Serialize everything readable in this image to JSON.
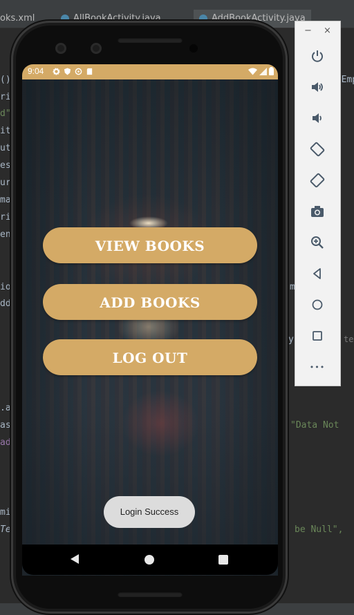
{
  "ide": {
    "tabs": [
      {
        "label": "oks.xml"
      },
      {
        "label": "AllBookActivity.java"
      },
      {
        "label": "AddBookActivity.java"
      }
    ],
    "code_left": [
      "()",
      "ri",
      "d\"",
      "it",
      "ut",
      "es",
      "ur",
      "ma",
      "ri",
      "en",
      "io",
      "dd",
      ".a",
      "as",
      "ad",
      "mi",
      "Te"
    ],
    "code_right": [
      {
        "text": "! Emp"
      },
      {
        "text": "\"Data Not"
      },
      {
        "text": "be Null\","
      },
      {
        "text": "tex"
      },
      {
        "text": "y"
      },
      {
        "text": "m"
      }
    ]
  },
  "status_bar": {
    "time": "9:04",
    "color": "#d4aa66"
  },
  "app": {
    "buttons": [
      {
        "label": "VIEW BOOKS"
      },
      {
        "label": "ADD BOOKS"
      },
      {
        "label": "LOG OUT"
      }
    ],
    "toast": "Login Success",
    "accent": "#d4aa66"
  },
  "nav": {
    "back_icon": "back-triangle-icon",
    "home_icon": "home-circle-icon",
    "recent_icon": "recents-square-icon"
  },
  "emulator_toolbar": {
    "minimize": "−",
    "close": "×",
    "tools": [
      "power-icon",
      "volume-up-icon",
      "volume-down-icon",
      "rotate-left-icon",
      "rotate-right-icon",
      "camera-icon",
      "zoom-icon",
      "back-icon",
      "home-icon",
      "overview-icon",
      "more-icon"
    ],
    "more": "•••"
  }
}
